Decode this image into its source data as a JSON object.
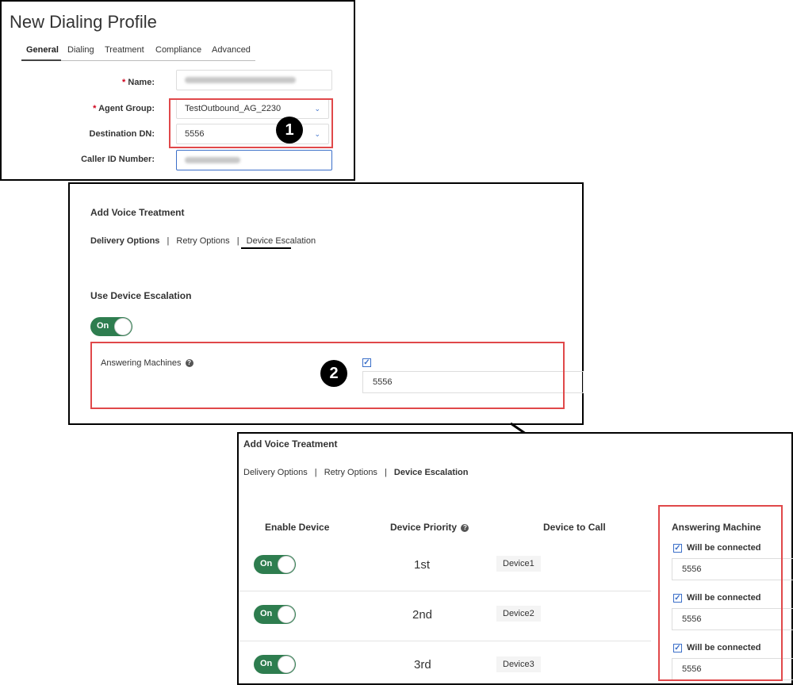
{
  "profile": {
    "title": "New Dialing Profile",
    "tabs": [
      "General",
      "Dialing",
      "Treatment",
      "Compliance",
      "Advanced"
    ],
    "active_tab": "General",
    "fields": {
      "name_label": "Name:",
      "agent_group_label": "Agent Group:",
      "agent_group_value": "TestOutbound_AG_2230",
      "destination_dn_label": "Destination DN:",
      "destination_dn_value": "5556",
      "caller_id_label": "Caller ID Number:"
    },
    "required_mark": "*",
    "callout": "1"
  },
  "treatment_a": {
    "title": "Add Voice Treatment",
    "nav": [
      "Delivery Options",
      "Retry Options",
      "Device Escalation"
    ],
    "separator": "|",
    "section_title": "Use Device Escalation",
    "toggle_label": "On",
    "answering_machines_label": "Answering Machines",
    "answering_machines_checked": true,
    "answering_machines_value": "5556",
    "callout": "2"
  },
  "treatment_b": {
    "title": "Add Voice Treatment",
    "nav": [
      "Delivery Options",
      "Retry Options",
      "Device Escalation"
    ],
    "separator": "|",
    "columns": [
      "Enable Device",
      "Device Priority",
      "Device to Call",
      "Answering Machine"
    ],
    "rows": [
      {
        "toggle": "On",
        "priority": "1st",
        "device": "Device1",
        "connected_label": "Will be connected",
        "checked": true,
        "value": "5556"
      },
      {
        "toggle": "On",
        "priority": "2nd",
        "device": "Device2",
        "connected_label": "Will be connected",
        "checked": true,
        "value": "5556"
      },
      {
        "toggle": "On",
        "priority": "3rd",
        "device": "Device3",
        "connected_label": "Will be connected",
        "checked": true,
        "value": "5556"
      }
    ]
  },
  "colors": {
    "accent_red": "#e0484a",
    "toggle_green": "#2e7d4f",
    "link_blue": "#3b6fc9"
  },
  "icons": {
    "help": "question-circle-icon",
    "dropdown": "chevron-down-icon",
    "checkbox": "checkbox-checked-icon"
  }
}
